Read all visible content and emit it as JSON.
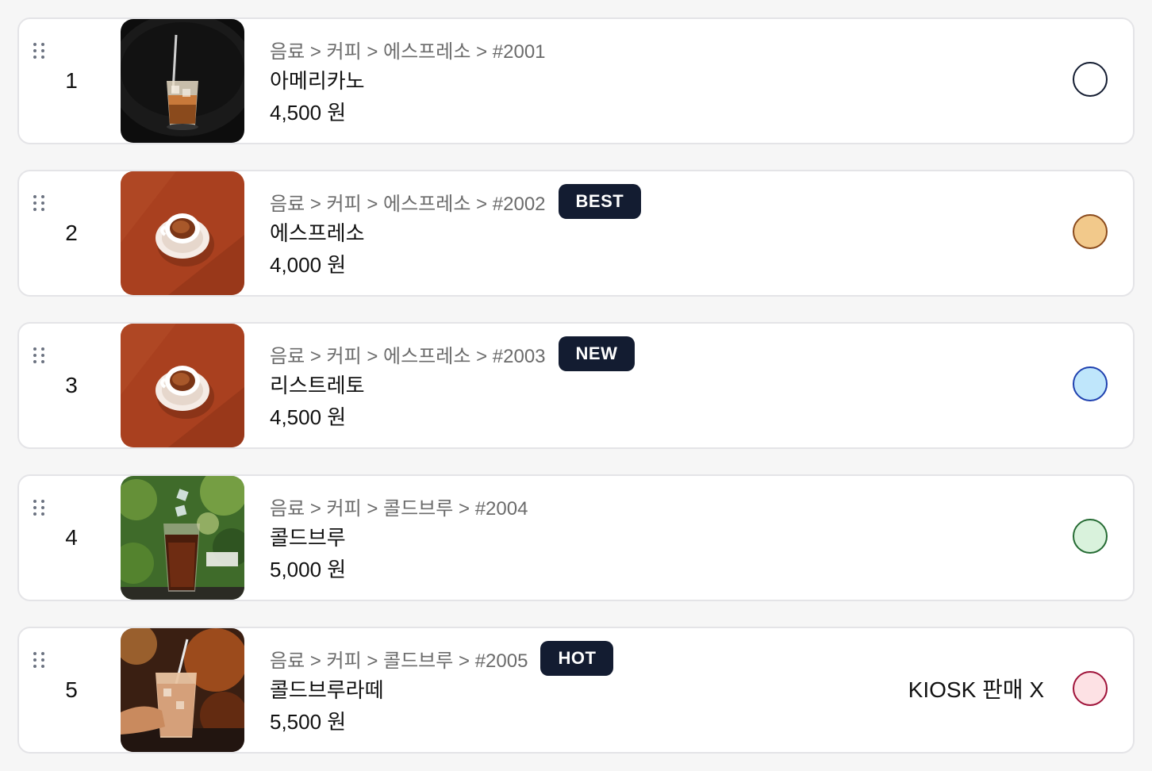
{
  "items": [
    {
      "index": "1",
      "breadcrumb": "음료 > 커피 > 에스프레소 > #2001",
      "badge": "",
      "name": "아메리카노",
      "price": "4,500 원",
      "kiosk_label": "",
      "image": "iced-americano-photo",
      "dot_fill": "#ffffff",
      "dot_border": "#131c31"
    },
    {
      "index": "2",
      "breadcrumb": "음료 > 커피 > 에스프레소 > #2002",
      "badge": "BEST",
      "name": "에스프레소",
      "price": "4,000 원",
      "kiosk_label": "",
      "image": "espresso-cup-photo",
      "dot_fill": "#f2c98b",
      "dot_border": "#8a4a1c"
    },
    {
      "index": "3",
      "breadcrumb": "음료 > 커피 > 에스프레소 > #2003",
      "badge": "NEW",
      "name": "리스트레토",
      "price": "4,500 원",
      "kiosk_label": "",
      "image": "espresso-cup-photo",
      "dot_fill": "#bfe6fb",
      "dot_border": "#1e40af"
    },
    {
      "index": "4",
      "breadcrumb": "음료 > 커피 > 콜드브루 > #2004",
      "badge": "",
      "name": "콜드브루",
      "price": "5,000 원",
      "kiosk_label": "",
      "image": "cold-brew-glass-photo",
      "dot_fill": "#d9f2dc",
      "dot_border": "#256b33"
    },
    {
      "index": "5",
      "breadcrumb": "음료 > 커피 > 콜드브루 > #2005",
      "badge": "HOT",
      "name": "콜드브루라떼",
      "price": "5,500 원",
      "kiosk_label": "KIOSK 판매 X",
      "image": "cold-brew-latte-photo",
      "dot_fill": "#fde1e4",
      "dot_border": "#9f1239"
    }
  ]
}
